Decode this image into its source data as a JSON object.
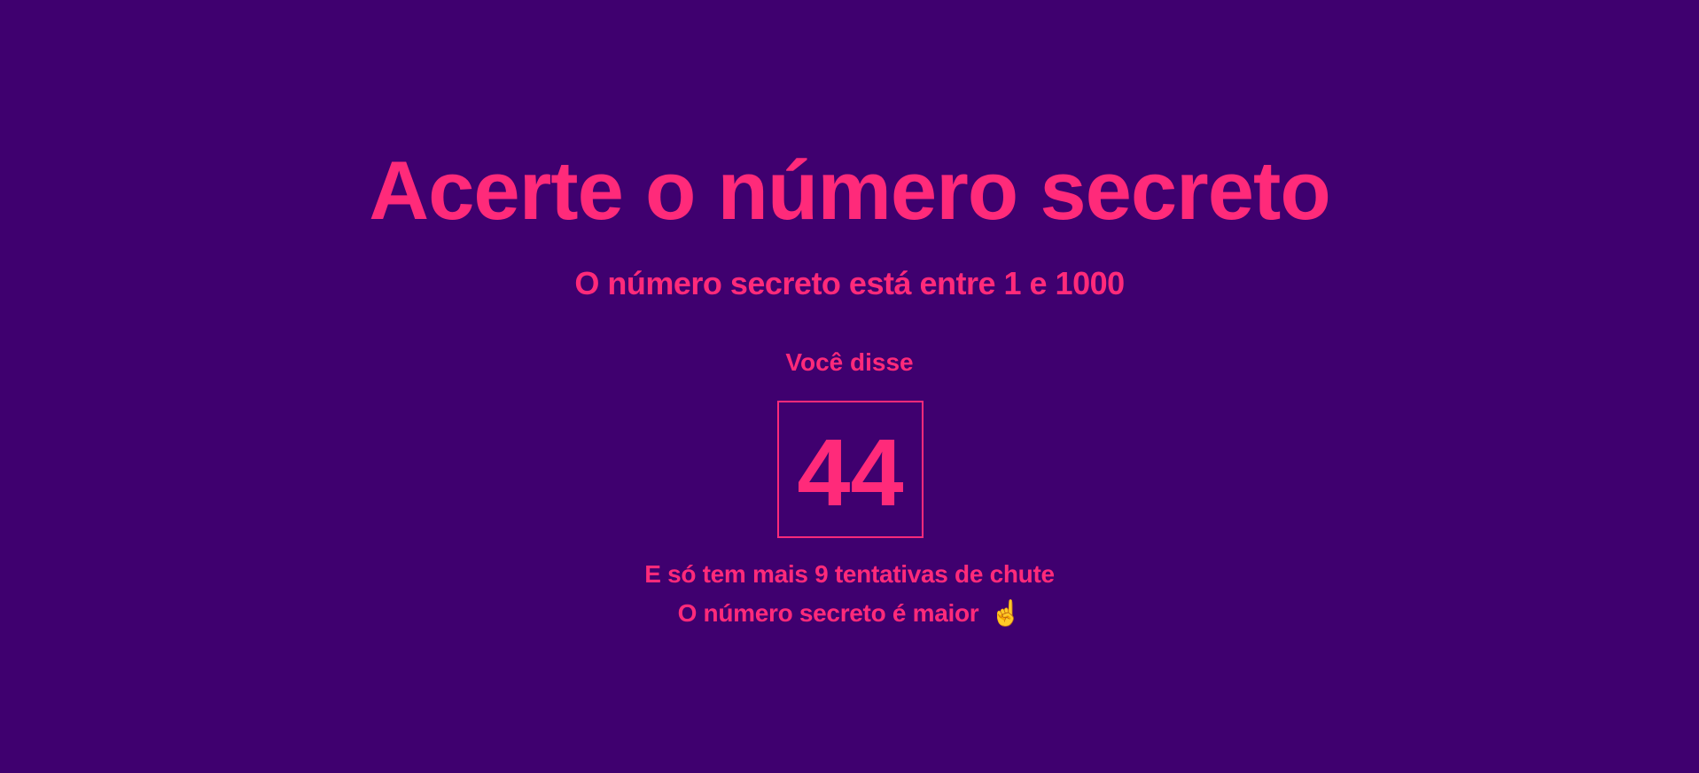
{
  "game": {
    "title": "Acerte o número secreto",
    "subtitle": "O número secreto está entre 1 e 1000",
    "guess_label": "Você disse",
    "guess_value": "44",
    "attempts_text": "E só tem mais 9 tentativas de chute",
    "hint_text": "O número secreto é maior",
    "hint_icon": "☝️",
    "hint_icon_name": "pointing-up-icon"
  },
  "colors": {
    "background": "#3f006f",
    "accent": "#ff2a7a"
  }
}
